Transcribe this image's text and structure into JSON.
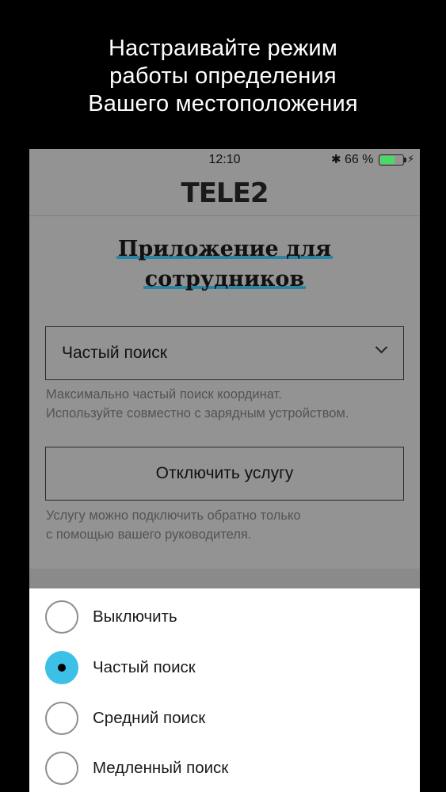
{
  "promo": {
    "lines": [
      "Настраивайте режим",
      "работы определения",
      "Вашего местоположения"
    ]
  },
  "status_bar": {
    "time": "12:10",
    "battery_percent": "66 %",
    "battery_level": 0.66,
    "icons": [
      "bluetooth-icon",
      "battery-icon",
      "charging-bolt-icon"
    ]
  },
  "header": {
    "logo": "TELE2"
  },
  "title": {
    "line1": "Приложение для",
    "line2": "сотрудников"
  },
  "mode_select": {
    "value": "Частый поиск",
    "hint_line1": "Максимально частый поиск координат.",
    "hint_line2": "Используйте совместно с зарядным устройством."
  },
  "disable_service": {
    "label": "Отключить услугу",
    "hint_line1": "Услугу можно подключить обратно только",
    "hint_line2": "с помощью вашего руководителя."
  },
  "sheet": {
    "options": [
      {
        "label": "Выключить",
        "selected": false
      },
      {
        "label": "Частый поиск",
        "selected": true
      },
      {
        "label": "Средний поиск",
        "selected": false
      },
      {
        "label": "Медленный поиск",
        "selected": false
      }
    ]
  },
  "colors": {
    "accent": "#3cc0e8",
    "backdrop": "#939393",
    "underline": "#2a85a5",
    "battery": "#4cd964"
  }
}
